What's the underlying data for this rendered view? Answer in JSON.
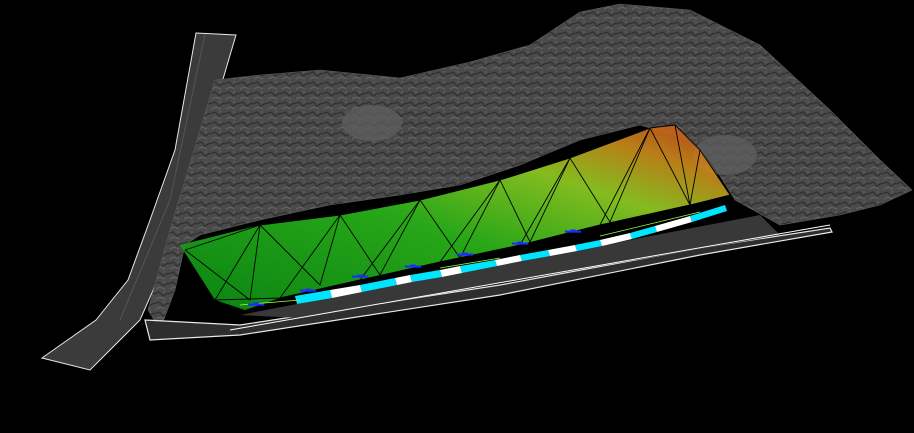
{
  "scene": {
    "background_color": "#000000",
    "terrain_color": "#4a4a4a",
    "road_color": "#3a3a3a",
    "road_edge_color": "#e8e8e8",
    "wall_gradient": [
      "#0a8f14",
      "#2bb51a",
      "#8fcc22",
      "#c88a1a",
      "#c2401a"
    ],
    "mesh_color": "#000000",
    "marker_colors": [
      "#00e5ff",
      "#ffffff"
    ],
    "label_color": "#1c2cff"
  },
  "labels": [
    {
      "id": "label-1",
      "text": "▂▃▂"
    },
    {
      "id": "label-2",
      "text": "▂▃▂"
    },
    {
      "id": "label-3",
      "text": "▂▃▂"
    },
    {
      "id": "label-4",
      "text": "▂▃▂"
    },
    {
      "id": "label-5",
      "text": "▂▃▂"
    },
    {
      "id": "label-6",
      "text": "▂▃▂"
    },
    {
      "id": "label-7",
      "text": "▂▃▂"
    }
  ]
}
